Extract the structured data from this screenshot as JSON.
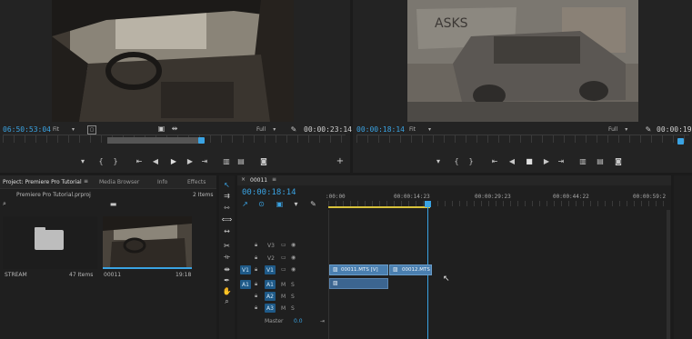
{
  "source_monitor": {
    "timecode_in": "06:50:53:04",
    "fit": "Fit",
    "quality": "Full",
    "duration": "00:00:23:14"
  },
  "program_monitor": {
    "timecode": "00:00:18:14",
    "fit": "Fit",
    "quality": "Full",
    "duration": "00:00:19:"
  },
  "project_panel": {
    "tabs": [
      "Project: Premiere Pro Tutorial",
      "Media Browser",
      "Info",
      "Effects"
    ],
    "file_name": "Premiere Pro Tutorial.prproj",
    "item_count": "2 Items",
    "items": [
      {
        "name": "STREAM",
        "info": "47 Items"
      },
      {
        "name": "00011",
        "info": "19:18"
      }
    ]
  },
  "timeline": {
    "tab": "00011",
    "timecode": "00:00:18:14",
    "ruler": [
      ":00:00",
      "00:00:14:23",
      "00:00:29:23",
      "00:00:44:22",
      "00:00:59:2"
    ],
    "video_tracks": [
      "V3",
      "V2",
      "V1"
    ],
    "audio_tracks": [
      "A1",
      "A2",
      "A3"
    ],
    "source_v": "V1",
    "source_a": "A1",
    "mute": "M",
    "solo": "S",
    "master_label": "Master",
    "master_value": "0.0",
    "clips": [
      {
        "label": "00011.MTS [V]",
        "track": "V1"
      },
      {
        "label": "00012.MTS",
        "track": "V1"
      }
    ]
  },
  "colors": {
    "accent": "#3aa3e3",
    "clip_video": "#4a7fb0",
    "clip_audio": "#3c6590"
  }
}
